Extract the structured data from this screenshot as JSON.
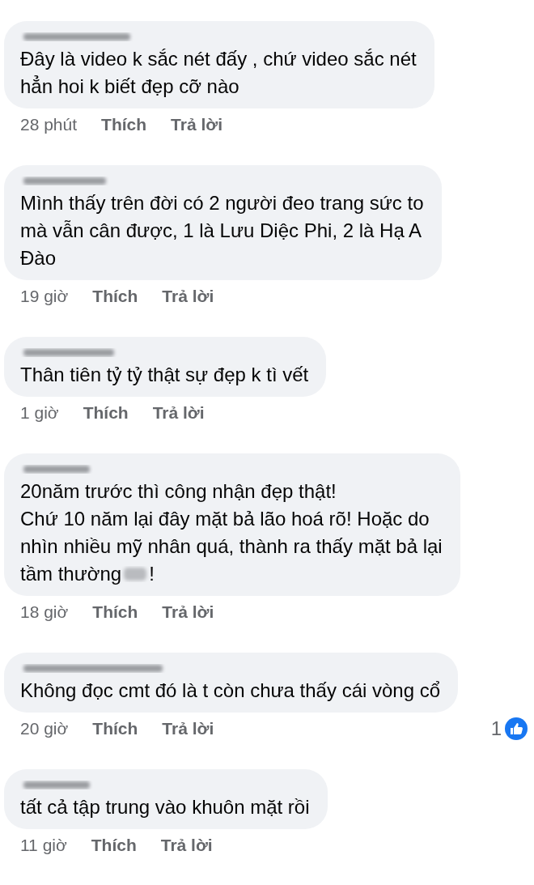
{
  "comments": [
    {
      "lines": [
        "Đây là video k sắc nét đấy , chứ video sắc nét",
        "hẳn hoi k biết đẹp cỡ nào"
      ],
      "time": "28 phút",
      "like": "Thích",
      "reply": "Trả lời"
    },
    {
      "lines": [
        "Mình thấy trên đời có 2 người đeo trang sức to",
        "mà vẫn cân được, 1 là Lưu Diệc Phi, 2 là Hạ A",
        "Đào"
      ],
      "time": "19 giờ",
      "like": "Thích",
      "reply": "Trả lời"
    },
    {
      "lines": [
        "Thân tiên tỷ tỷ thật sự đẹp k tì vết"
      ],
      "time": "1 giờ",
      "like": "Thích",
      "reply": "Trả lời"
    },
    {
      "lines": [
        "20năm trước thì công nhận đẹp thật!",
        "Chứ 10 năm lại đây mặt bả lão hoá rõ! Hoặc do",
        "nhìn nhiều mỹ nhân quá, thành ra thấy mặt bả lại",
        {
          "kind": "sticker",
          "before": "tầm thường",
          "after": "!"
        }
      ],
      "time": "18 giờ",
      "like": "Thích",
      "reply": "Trả lời"
    },
    {
      "lines": [
        "Không đọc cmt đó là t còn chưa thấy cái vòng cổ"
      ],
      "time": "20 giờ",
      "like": "Thích",
      "reply": "Trả lời",
      "reactions": "1"
    },
    {
      "lines": [
        "tất cả tập trung vào khuôn mặt rồi"
      ],
      "time": "11 giờ",
      "like": "Thích",
      "reply": "Trả lời"
    }
  ]
}
